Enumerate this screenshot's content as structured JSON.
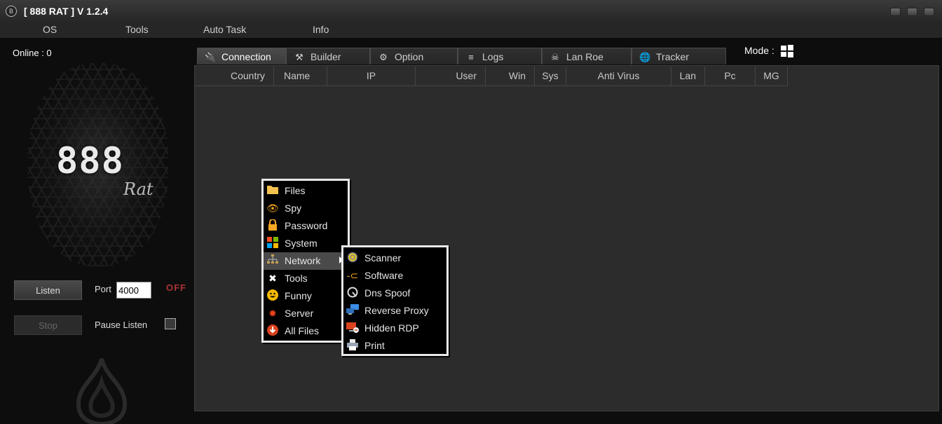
{
  "window": {
    "title": "[ 888 RAT ] V 1.2.4"
  },
  "menubar": [
    "OS",
    "Tools",
    "Auto Task",
    "Info"
  ],
  "left": {
    "online": "Online : 0",
    "logo_text": "888",
    "logo_sub": "Rat",
    "listen_label": "Listen",
    "port_label": "Port",
    "port_value": "4000",
    "status": "OFF",
    "stop_label": "Stop",
    "pause_label": "Pause Listen",
    "pause_checked": false
  },
  "tabs": [
    {
      "label": "Connection",
      "icon": "plug-icon",
      "active": true
    },
    {
      "label": "Builder",
      "icon": "tools-icon",
      "active": false
    },
    {
      "label": "Option",
      "icon": "gear-icon",
      "active": false
    },
    {
      "label": "Logs",
      "icon": "database-icon",
      "active": false
    },
    {
      "label": "Lan Roe",
      "icon": "skull-icon",
      "active": false
    },
    {
      "label": "Tracker",
      "icon": "globe-icon",
      "active": false
    }
  ],
  "mode": {
    "label": "Mode :",
    "icon": "windows-icon"
  },
  "columns": [
    "Country",
    "Name",
    "IP",
    "User",
    "Win",
    "Sys",
    "Anti Virus",
    "Lan",
    "Pc",
    "MG"
  ],
  "context_menu": {
    "items": [
      {
        "label": "Files",
        "icon": "folder-icon"
      },
      {
        "label": "Spy",
        "icon": "eye-icon"
      },
      {
        "label": "Password",
        "icon": "lock-icon"
      },
      {
        "label": "System",
        "icon": "windows-icon"
      },
      {
        "label": "Network",
        "icon": "network-icon",
        "submenu": true,
        "highlighted": true
      },
      {
        "label": "Tools",
        "icon": "wrench-icon"
      },
      {
        "label": "Funny",
        "icon": "smiley-icon"
      },
      {
        "label": "Server",
        "icon": "virus-icon"
      },
      {
        "label": "All Files",
        "icon": "download-icon"
      }
    ]
  },
  "submenu": {
    "items": [
      {
        "label": "Scanner",
        "icon": "radar-icon"
      },
      {
        "label": "Software",
        "icon": "plug-icon"
      },
      {
        "label": "Dns Spoof",
        "icon": "spoof-icon"
      },
      {
        "label": "Reverse Proxy",
        "icon": "monitors-icon"
      },
      {
        "label": "Hidden RDP",
        "icon": "rdp-icon"
      },
      {
        "label": "Print",
        "icon": "printer-icon"
      }
    ]
  }
}
